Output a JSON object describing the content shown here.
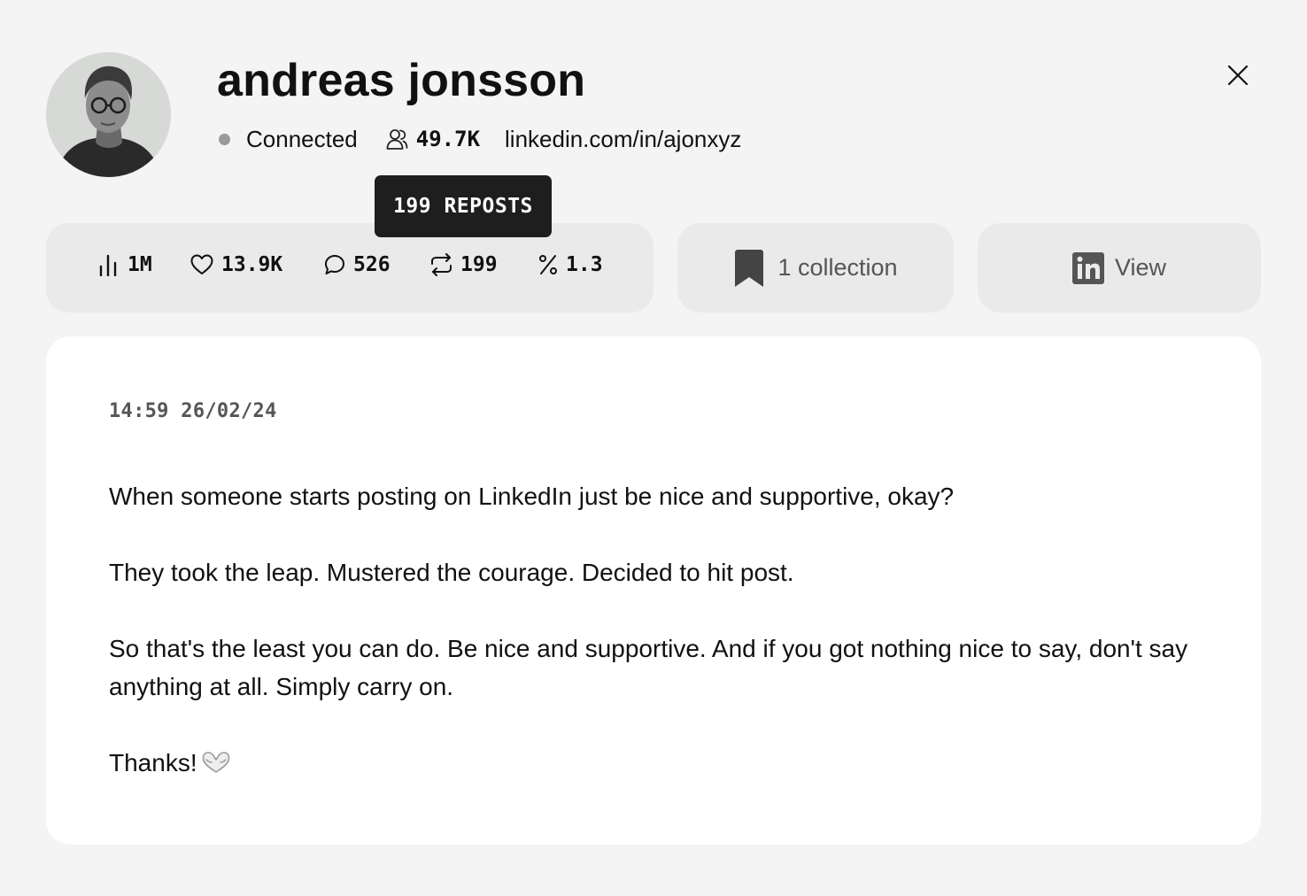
{
  "profile": {
    "name": "andreas jonsson",
    "status": "Connected",
    "followers": "49.7K",
    "link": "linkedin.com/in/ajonxyz"
  },
  "tooltip": {
    "text": "199 REPOSTS"
  },
  "stats": {
    "impressions": "1M",
    "likes": "13.9K",
    "comments": "526",
    "reposts": "199",
    "engagement": "1.3"
  },
  "actions": {
    "collection_label": "1 collection",
    "view_label": "View"
  },
  "post": {
    "timestamp": "14:59 26/02/24",
    "paragraphs": [
      "When someone starts posting on LinkedIn just be nice and supportive, okay?",
      "They took the leap. Mustered the courage. Decided to hit post.",
      "So that's the least you can do. Be nice and supportive. And if you got nothing nice to say, don't say anything at all. Simply carry on.",
      "Thanks!"
    ]
  },
  "icons": {
    "avatar": "profile-photo",
    "followers": "users-icon",
    "close": "close-icon",
    "impressions": "bar-chart-icon",
    "likes": "heart-icon",
    "comments": "comment-icon",
    "reposts": "repost-icon",
    "engagement": "percent-icon",
    "collection": "bookmark-icon",
    "view": "linkedin-icon",
    "emoji": "heart-hands-emoji"
  },
  "colors": {
    "background": "#f3f4f3",
    "card": "#e9eae9",
    "post_card": "#ffffff",
    "tooltip": "#1e1e1e",
    "status_dot": "#9a9a9a",
    "muted_text": "#555555"
  }
}
